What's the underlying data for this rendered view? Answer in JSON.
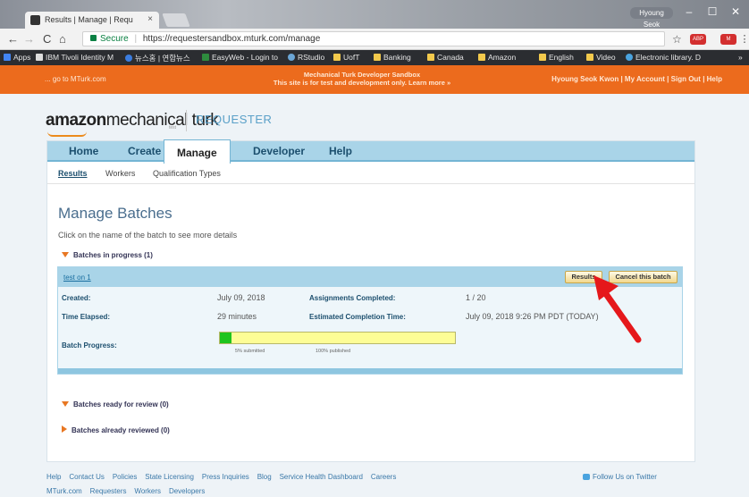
{
  "browser": {
    "tab_title": "Results | Manage | Requ",
    "tab_close": "×",
    "profile": "Hyoung Seok",
    "window_controls": [
      "–",
      "☐",
      "✕"
    ],
    "nav": {
      "back": "←",
      "forward": "→",
      "reload": "C",
      "home": "⌂"
    },
    "url_secure": "Secure",
    "url_sep": "|",
    "url": "https://requestersandbox.mturk.com/manage",
    "star": "☆",
    "extensions": [
      {
        "label": "ABP",
        "color": "#d32f2f"
      },
      {
        "label": "M",
        "color": "#c62828"
      },
      {
        "label": "⋮",
        "color": "#f2f2f2"
      }
    ],
    "bookmarks": [
      "Apps",
      "IBM Tivoli Identity M",
      "뉴스홈 | 연합뉴스",
      "EasyWeb - Login to",
      "RStudio",
      "UofT",
      "Banking",
      "Canada",
      "Amazon",
      "English",
      "Video",
      "Electronic library. D"
    ],
    "bookmarks_overflow": "»"
  },
  "topbar": {
    "goto": "... go to MTurk.com",
    "sandbox_line1": "Mechanical Turk Developer Sandbox",
    "sandbox_line2": "This site is for test and development only. Learn more »",
    "account": "Hyoung Seok Kwon | My Account | Sign Out | Help"
  },
  "logo": {
    "amazon": "amazon",
    "mechanicalturk": "mechanical turk",
    "test": "test",
    "requester": "REQUESTER"
  },
  "main_tabs": [
    "Home",
    "Create",
    "Manage",
    "Developer",
    "Help"
  ],
  "active_tab": "Manage",
  "sub_tabs": [
    "Results",
    "Workers",
    "Qualification Types"
  ],
  "page_title": "Manage Batches",
  "instructions": "Click on the name of the batch to see more details",
  "sections": {
    "in_progress": "Batches in progress (1)",
    "ready": "Batches ready for review (0)",
    "reviewed": "Batches already reviewed (0)"
  },
  "batch": {
    "name": "test on 1",
    "results_button": "Results",
    "cancel_button": "Cancel this batch",
    "created_label": "Created:",
    "created_value": "July 09, 2018",
    "elapsed_label": "Time Elapsed:",
    "elapsed_value": "29 minutes",
    "assignments_label": "Assignments Completed:",
    "assignments_value": "1 / 20",
    "estimate_label": "Estimated Completion Time:",
    "estimate_value": "July 09, 2018 9:26 PM PDT (TODAY)",
    "progress_label": "Batch Progress:",
    "submitted_fraction": 0.05,
    "submitted_label": "5% submitted",
    "published_label": "100% published"
  },
  "footer": {
    "row1": [
      "Help",
      "Contact Us",
      "Policies",
      "State Licensing",
      "Press Inquiries",
      "Blog",
      "Service Health Dashboard",
      "Careers"
    ],
    "row2": [
      "MTurk.com",
      "Requesters",
      "Workers",
      "Developers"
    ],
    "twitter": "Follow Us on Twitter"
  },
  "colors": {
    "accent_orange": "#ec6b1d",
    "nav_blue": "#a9d4e8",
    "annotation_arrow": "#e5181b"
  }
}
